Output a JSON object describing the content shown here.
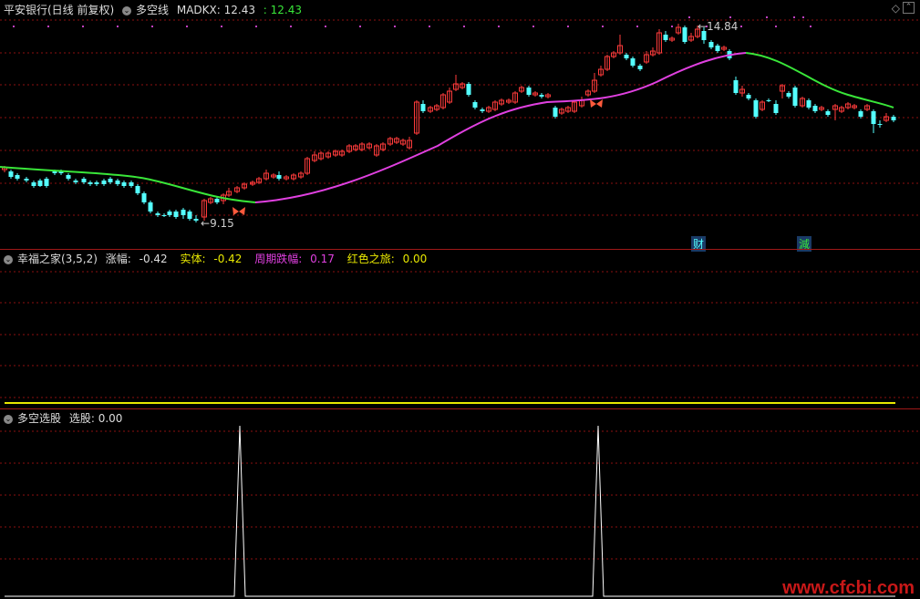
{
  "main_pane": {
    "stock_title": "平安银行(日线 前复权)",
    "indicator_name": "多空线",
    "madkx_label": "MADKX: 12.43",
    "madkx_value2": ": 12.43",
    "high_label": "14.84",
    "low_label": "9.15",
    "badge_fin": "财",
    "badge_reduce": "減"
  },
  "sub_pane1": {
    "indicator_name": "幸福之家(3,5,2)",
    "fields": [
      {
        "label": "涨幅:",
        "value": "-0.42",
        "color": "#dddddd"
      },
      {
        "label": "实体:",
        "value": "-0.42",
        "color": "#e8e800"
      },
      {
        "label": "周期跌幅:",
        "value": "0.17",
        "color": "#e040e0"
      },
      {
        "label": "红色之旅:",
        "value": "0.00",
        "color": "#e8e800"
      }
    ]
  },
  "sub_pane2": {
    "indicator_name": "多空选股",
    "field_label": "选股: 0.00"
  },
  "watermark": "www.cfcbi.com",
  "colors": {
    "up": "#ff3b3b",
    "down": "#54ffff",
    "ma_bull": "#e040e0",
    "ma_bear": "#39e639",
    "grid": "#8b1010",
    "yellow": "#e8e800"
  },
  "chart_data": {
    "type": "candlestick",
    "title": "平安银行(日线 前复权)",
    "price_range": [
      8.5,
      15.5
    ],
    "series_ma": {
      "name": "MADKX",
      "last": 12.43
    },
    "annotations": [
      {
        "text": "14.84",
        "kind": "high"
      },
      {
        "text": "9.15",
        "kind": "low"
      }
    ],
    "signal_series": {
      "name": "选股",
      "peaks_at_fraction_of_period": [
        0.26,
        0.65
      ],
      "last": 0.0
    }
  }
}
